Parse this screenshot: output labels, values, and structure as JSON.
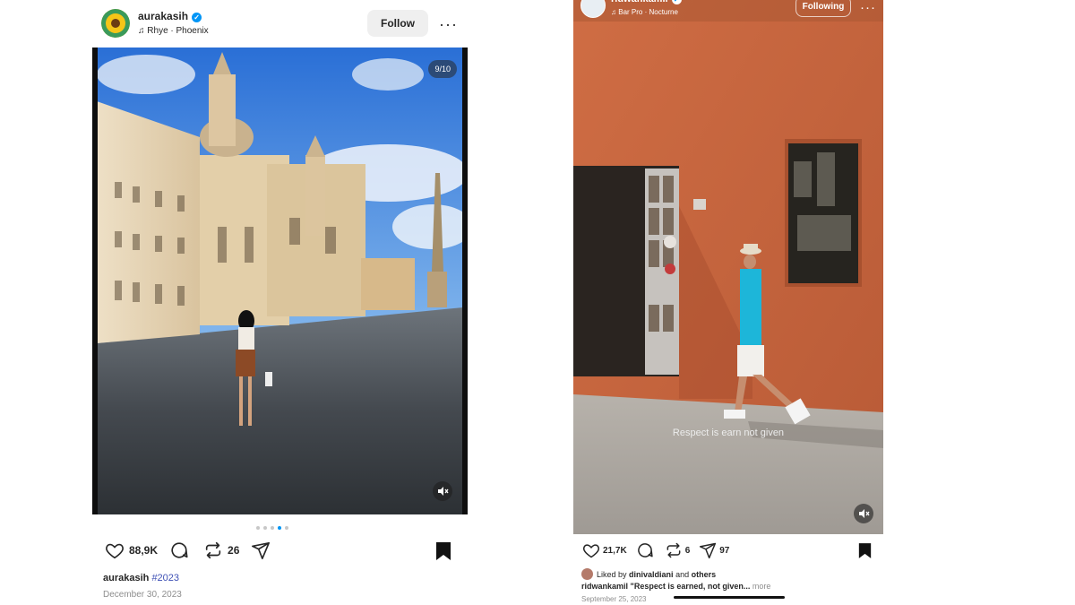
{
  "post1": {
    "username": "aurakasih",
    "music": "Rhye · Phoenix",
    "follow_label": "Follow",
    "more_label": "···",
    "image_counter": "9/10",
    "likes": "88,9K",
    "reposts": "26",
    "caption_user": "aurakasih",
    "caption_hashtag": "#2023",
    "date": "December 30, 2023"
  },
  "post2": {
    "username": "ridwankamil",
    "music": "Bar Pro · Nocturne",
    "following_label": "Following",
    "more_label": "···",
    "overlay_text": "Respect is earn not given",
    "likes": "21,7K",
    "reposts": "6",
    "shares": "97",
    "liked_by_prefix": "Liked by",
    "liked_by_user": "dinivaldiani",
    "liked_by_and": "and",
    "liked_by_others": "others",
    "caption_user": "ridwankamil",
    "caption_text": "\"Respect is earned, not given...",
    "caption_more": "more",
    "date": "September 25, 2023"
  },
  "colors": {
    "accent": "#0095f6",
    "hashtag": "#3f51b5",
    "wall": "#c8683f"
  },
  "icons": [
    "verified-badge-icon",
    "music-note-icon",
    "heart-icon",
    "comment-icon",
    "repost-icon",
    "send-icon",
    "bookmark-icon",
    "mute-icon"
  ]
}
